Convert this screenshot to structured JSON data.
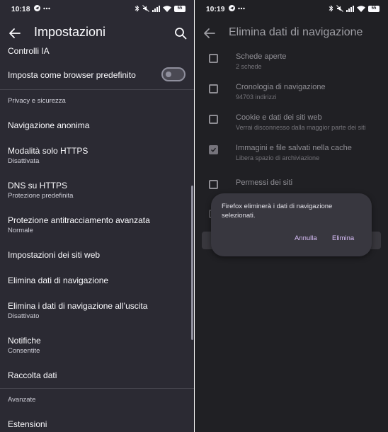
{
  "left": {
    "status": {
      "time": "10:18"
    },
    "title": "Impostazioni",
    "items": [
      {
        "title": "Controlli IA"
      },
      {
        "title": "Imposta come browser predefinito"
      },
      {
        "section": "Privacy e sicurezza"
      },
      {
        "title": "Navigazione anonima"
      },
      {
        "title": "Modalità solo HTTPS",
        "subtitle": "Disattivata"
      },
      {
        "title": "DNS su HTTPS",
        "subtitle": "Protezione predefinita"
      },
      {
        "title": "Protezione antitracciamento avanzata",
        "subtitle": "Normale"
      },
      {
        "title": "Impostazioni dei siti web"
      },
      {
        "title": "Elimina dati di navigazione"
      },
      {
        "title": "Elimina i dati di navigazione all’uscita",
        "subtitle": "Disattivato"
      },
      {
        "title": "Notifiche",
        "subtitle": "Consentite"
      },
      {
        "title": "Raccolta dati"
      },
      {
        "section": "Avanzate"
      },
      {
        "title": "Estensioni"
      }
    ],
    "default_browser_toggle": "off"
  },
  "right": {
    "status": {
      "time": "10:19"
    },
    "title": "Elimina dati di navigazione",
    "options": [
      {
        "title": "Schede aperte",
        "subtitle": "2 schede",
        "checked": false
      },
      {
        "title": "Cronologia di navigazione",
        "subtitle": "94703 indirizzi",
        "checked": false
      },
      {
        "title": "Cookie e dati dei siti web",
        "subtitle": "Verrai disconnesso dalla maggior parte dei siti",
        "checked": false
      },
      {
        "title": "Immagini e file salvati nella cache",
        "subtitle": "Libera spazio di archiviazione",
        "checked": true
      },
      {
        "title": "Permessi dei siti",
        "checked": false
      }
    ],
    "dialog": {
      "message": "Firefox eliminerà i dati di navigazione selezionati.",
      "cancel": "Annulla",
      "confirm": "Elimina"
    }
  },
  "status_battery": "55",
  "colors": {
    "accent": "#d9bff9",
    "surface": "#2b2a33"
  }
}
